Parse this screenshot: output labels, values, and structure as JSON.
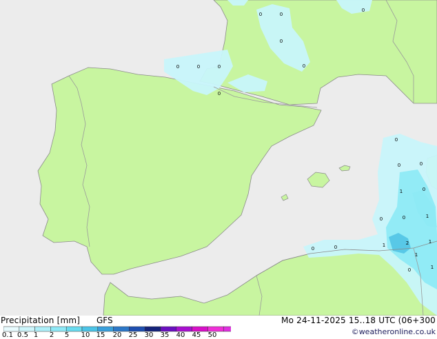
{
  "legend": {
    "title": "Precipitation [mm]",
    "model": "GFS",
    "ticks": [
      "0.1",
      "0.5",
      "1",
      "2",
      "5",
      "10",
      "15",
      "20",
      "25",
      "30",
      "35",
      "40",
      "45",
      "50"
    ],
    "colors": [
      "#e8fbfe",
      "#cdf6fc",
      "#aef0fa",
      "#8ee9f7",
      "#6adcf0",
      "#4cc4e7",
      "#3aa0dc",
      "#2c78c8",
      "#1f4fb0",
      "#14237a",
      "#6a0fc0",
      "#a80fd0",
      "#d810c8",
      "#f030d8",
      "#e030e0"
    ]
  },
  "valid_time": "Mo 24-11-2025 15..18 UTC (06+300",
  "credit": "©weatheronline.co.uk",
  "map": {
    "colors": {
      "sea": "#ececec",
      "land": "#c8f5a0",
      "border": "#9a9a9a",
      "coast": "#8a8a8a",
      "light_precip": "#c8f6fb",
      "mid_precip": "#8eeaf5",
      "heavy_precip": "#55c6e6"
    },
    "precip_values": [
      {
        "id": "p1",
        "text": "0"
      },
      {
        "id": "p2",
        "text": "0"
      },
      {
        "id": "p3",
        "text": "0"
      },
      {
        "id": "p4",
        "text": "0"
      },
      {
        "id": "p5",
        "text": "0"
      },
      {
        "id": "p6",
        "text": "0"
      },
      {
        "id": "p7",
        "text": "0"
      },
      {
        "id": "p8",
        "text": "0"
      },
      {
        "id": "p9",
        "text": "0"
      },
      {
        "id": "p10",
        "text": "0"
      },
      {
        "id": "p11",
        "text": "0"
      },
      {
        "id": "p12",
        "text": "0"
      },
      {
        "id": "p13",
        "text": "0"
      },
      {
        "id": "p14",
        "text": "1"
      },
      {
        "id": "p15",
        "text": "1"
      },
      {
        "id": "p16",
        "text": "0"
      },
      {
        "id": "p17",
        "text": "0"
      },
      {
        "id": "p18",
        "text": "1"
      },
      {
        "id": "p19",
        "text": "0"
      },
      {
        "id": "p20",
        "text": "0"
      },
      {
        "id": "p21",
        "text": "1"
      },
      {
        "id": "p22",
        "text": "2"
      },
      {
        "id": "p23",
        "text": "1"
      },
      {
        "id": "p24",
        "text": "1"
      },
      {
        "id": "p25",
        "text": "0"
      }
    ]
  }
}
